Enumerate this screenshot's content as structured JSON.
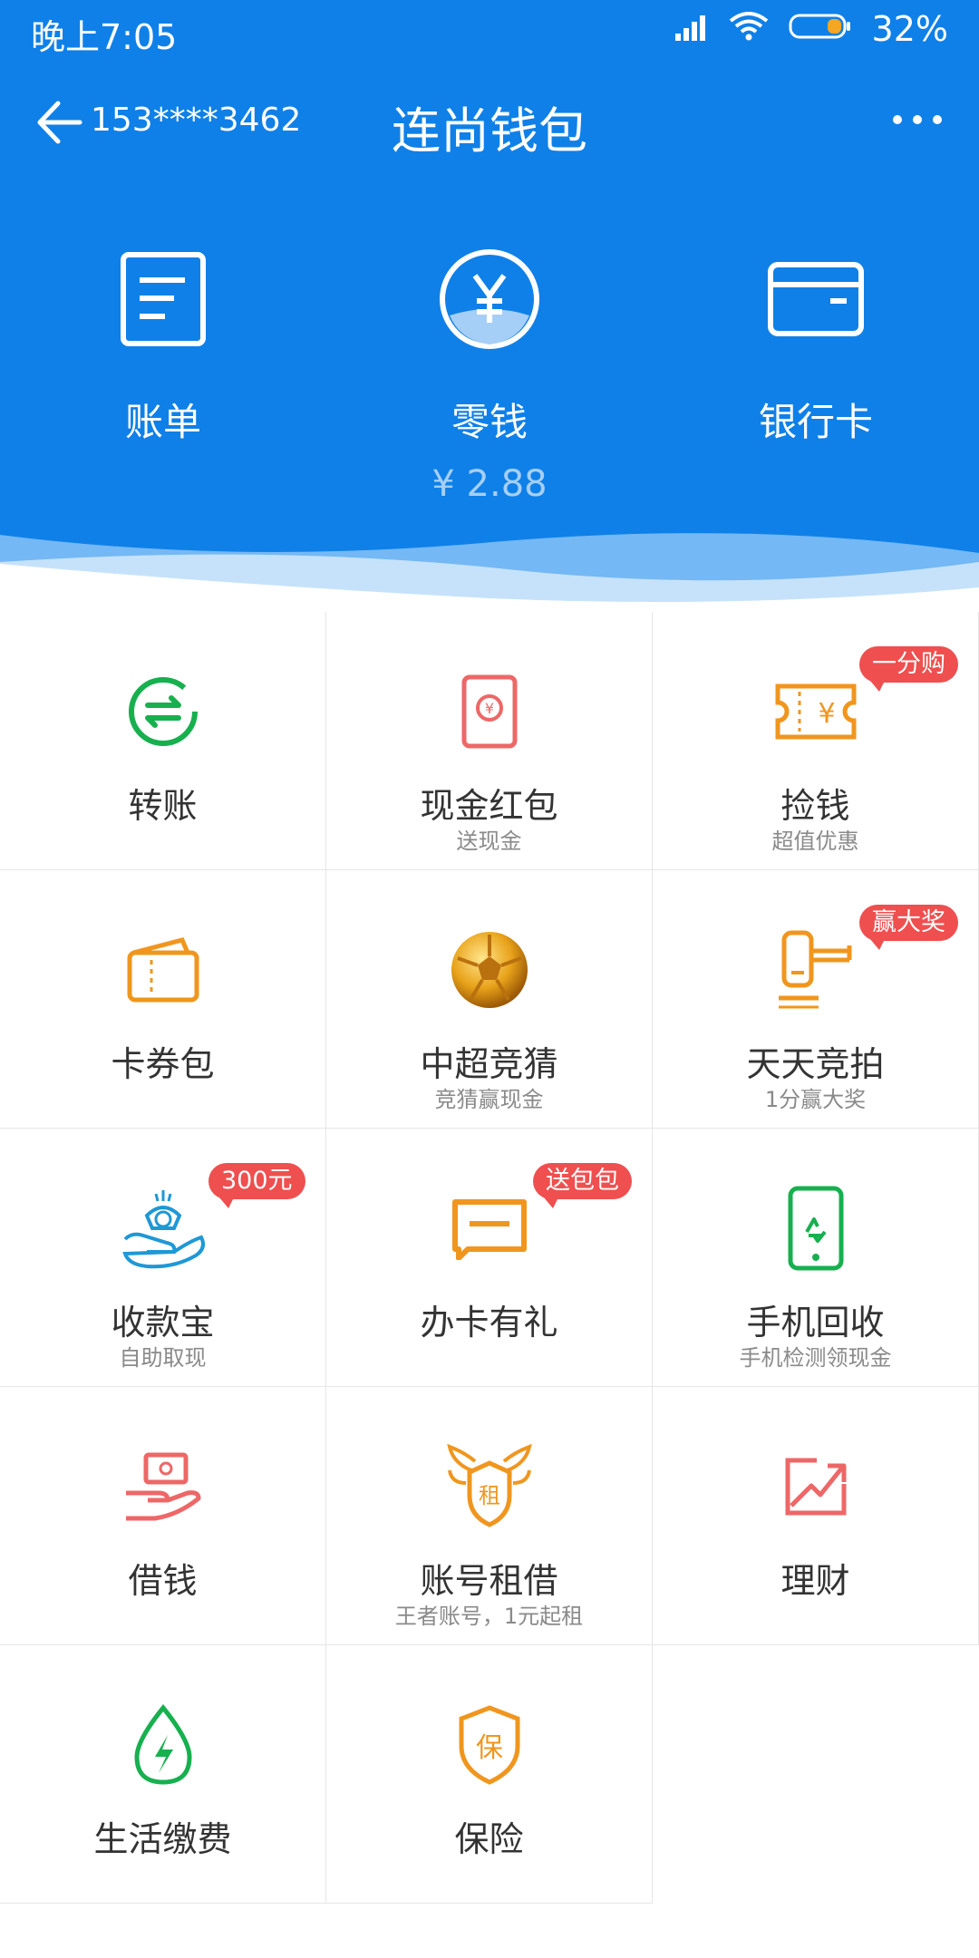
{
  "status_bar": {
    "time": "晚上7:05",
    "battery": "32%"
  },
  "navbar": {
    "account": "153****3462",
    "title": "连尚钱包"
  },
  "top_nav": [
    {
      "label": "账单"
    },
    {
      "label": "零钱",
      "balance": "¥ 2.88"
    },
    {
      "label": "银行卡"
    }
  ],
  "grid": [
    {
      "label": "转账",
      "sub": ""
    },
    {
      "label": "现金红包",
      "sub": "送现金"
    },
    {
      "label": "捡钱",
      "sub": "超值优惠",
      "badge": "一分购"
    },
    {
      "label": "卡券包",
      "sub": ""
    },
    {
      "label": "中超竞猜",
      "sub": "竞猜赢现金"
    },
    {
      "label": "天天竞拍",
      "sub": "1分赢大奖",
      "badge": "赢大奖"
    },
    {
      "label": "收款宝",
      "sub": "自助取现",
      "badge": "300元"
    },
    {
      "label": "办卡有礼",
      "sub": "",
      "badge": "送包包"
    },
    {
      "label": "手机回收",
      "sub": "手机检测领现金"
    },
    {
      "label": "借钱",
      "sub": ""
    },
    {
      "label": "账号租借",
      "sub": "王者账号，1元起租"
    },
    {
      "label": "理财",
      "sub": ""
    },
    {
      "label": "生活缴费",
      "sub": ""
    },
    {
      "label": "保险",
      "sub": ""
    }
  ],
  "colors": {
    "brand_blue": "#0f80e8",
    "green": "#17b04f",
    "orange": "#f0961e",
    "red": "#ef4f4f",
    "pink": "#ee6767",
    "teal": "#1e98d6"
  },
  "icons": [
    "back-arrow-icon",
    "more-dots-icon",
    "bill-icon",
    "yuan-coin-icon",
    "bank-card-icon",
    "transfer-icon",
    "red-envelope-icon",
    "ticket-icon",
    "card-wallet-icon",
    "football-icon",
    "auction-hammer-icon",
    "money-bag-hand-icon",
    "card-icon",
    "phone-recycle-icon",
    "loan-hand-icon",
    "rent-shield-icon",
    "trend-chart-icon",
    "water-bolt-icon",
    "insurance-shield-icon"
  ]
}
